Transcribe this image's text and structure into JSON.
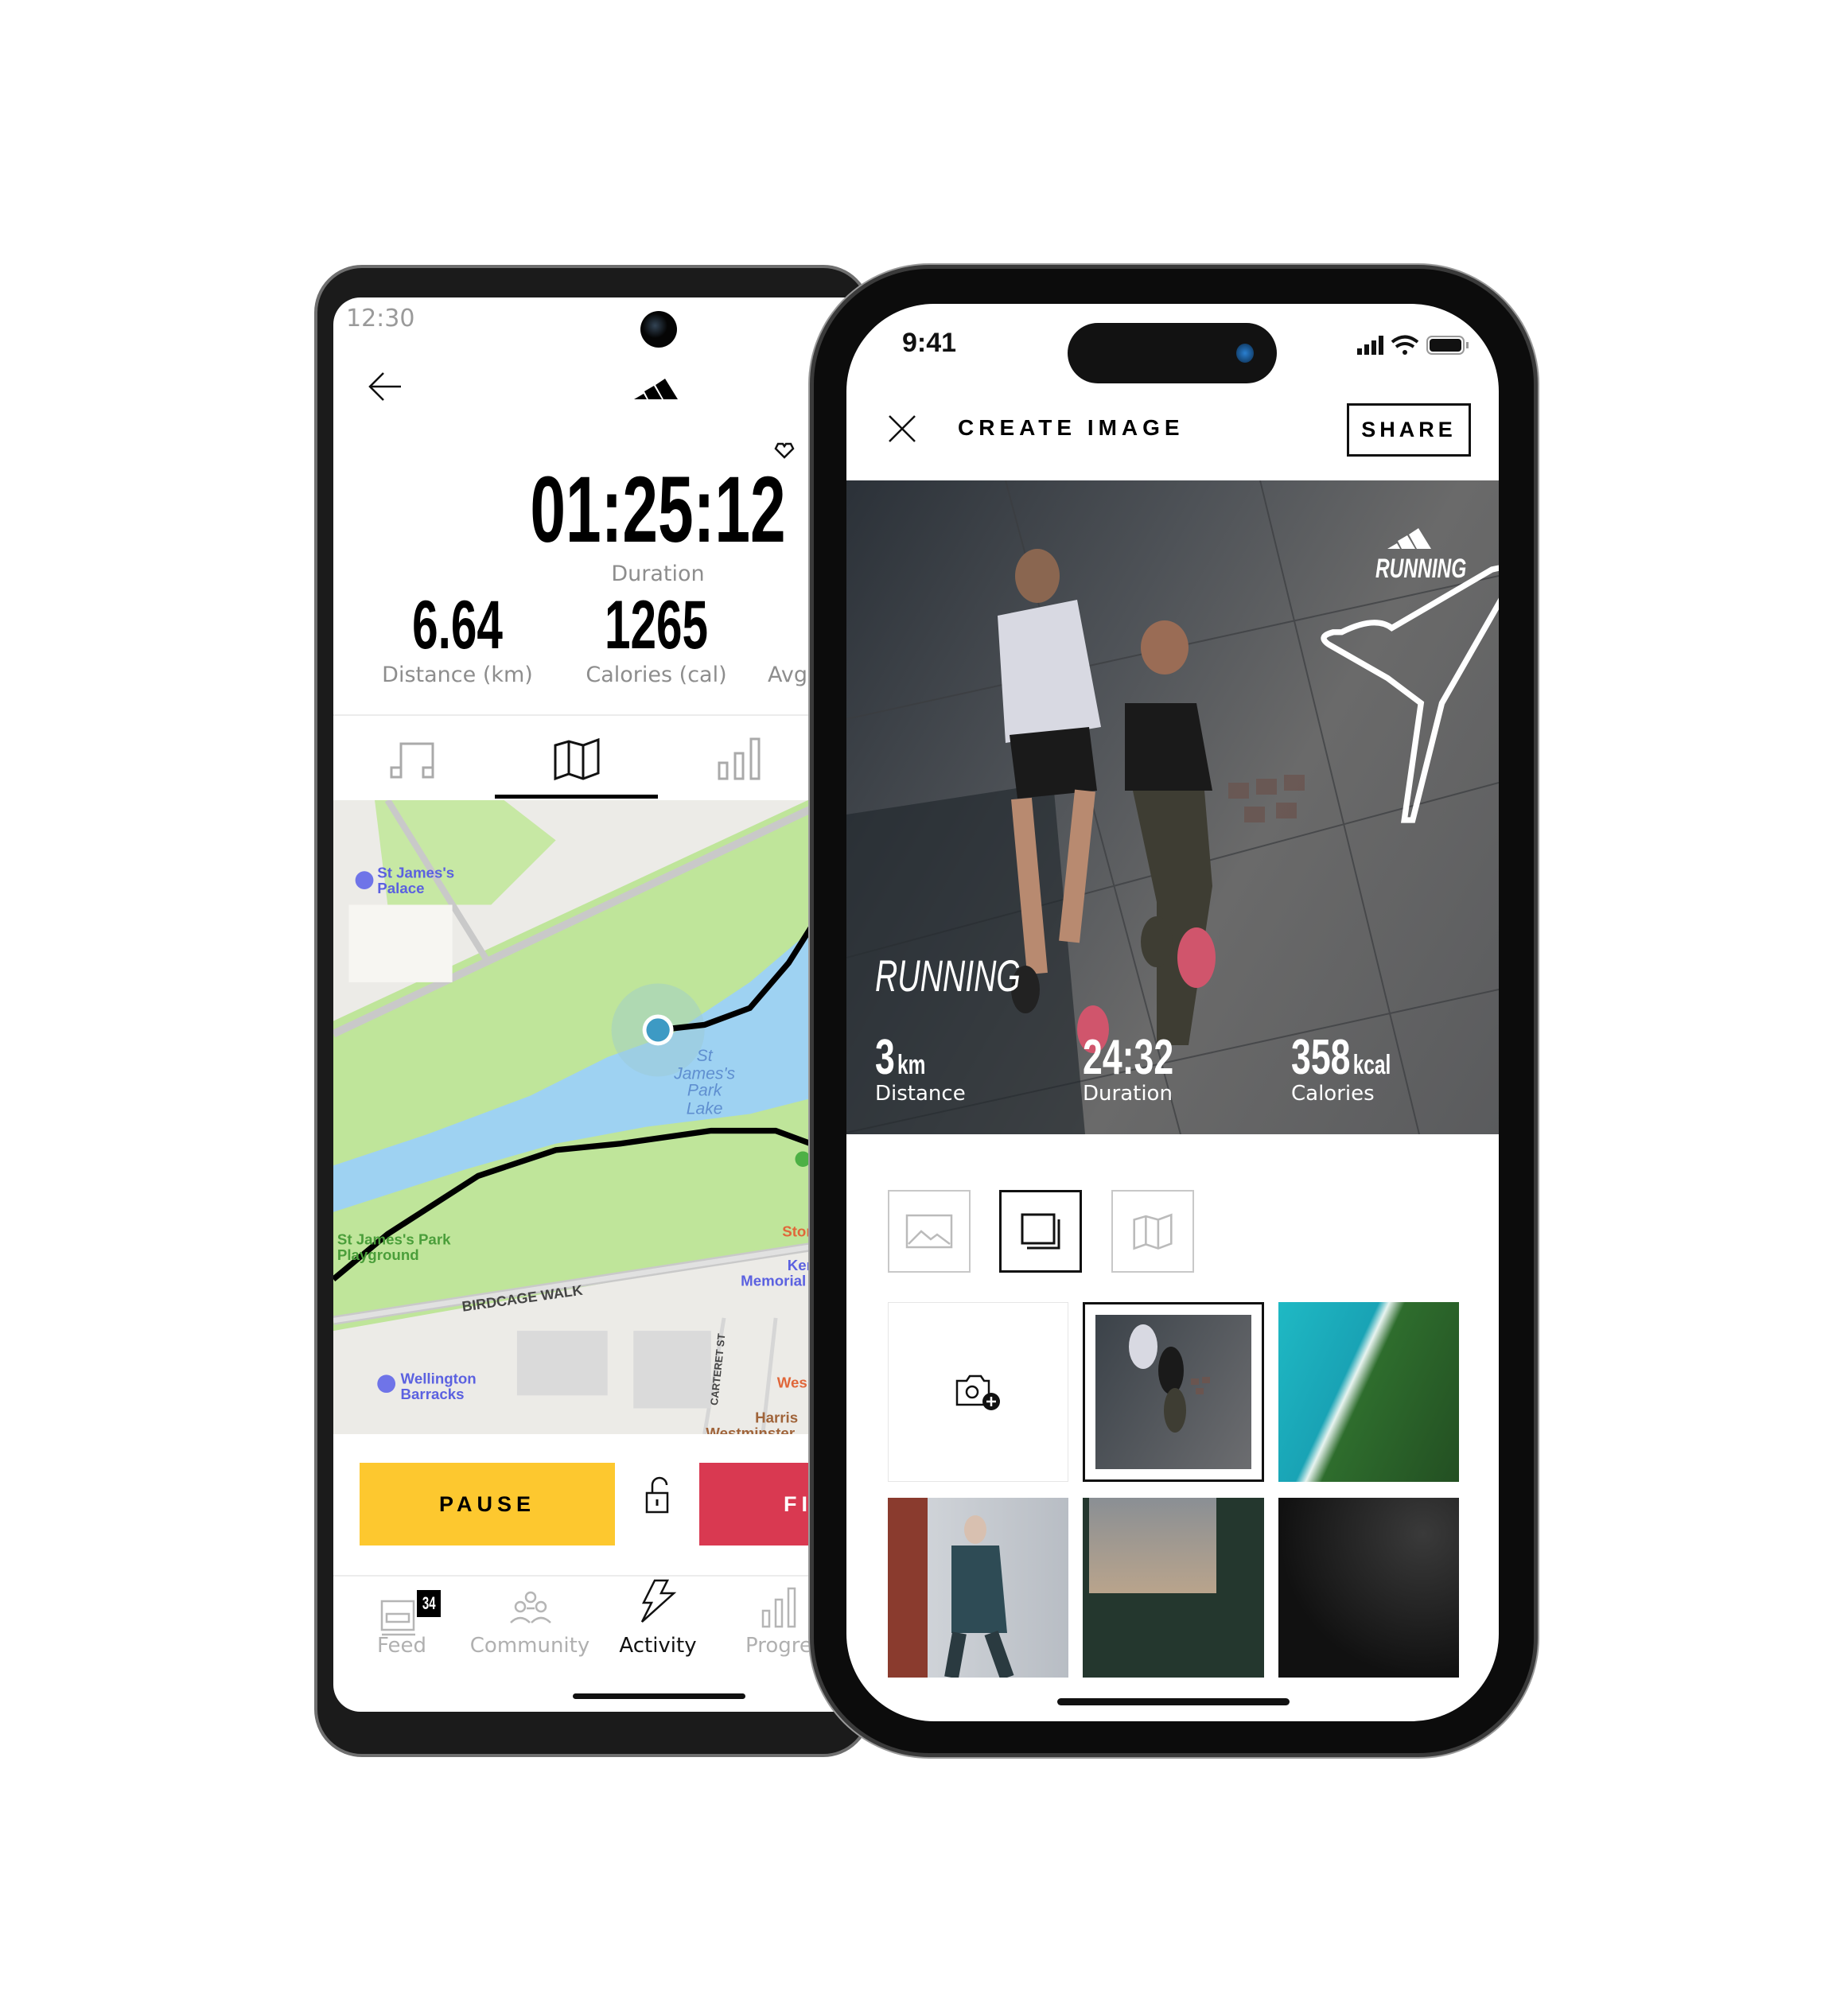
{
  "android": {
    "status_time": "12:30",
    "duration_value": "01:25:12",
    "duration_label": "Duration",
    "distance_value": "6.64",
    "distance_label": "Distance (km)",
    "calories_value": "1265",
    "calories_label": "Calories (cal)",
    "avg_label": "Avg.",
    "tabs": [
      {
        "icon": "music-icon",
        "active": false
      },
      {
        "icon": "map-icon",
        "active": true
      },
      {
        "icon": "stats-icon",
        "active": false
      }
    ],
    "map_labels": {
      "palace_1": "St James's",
      "palace_2": "Palace",
      "lake_1": "St",
      "lake_2": "James's",
      "lake_3": "Park",
      "lake_4": "Lake",
      "playground_1": "St James's Park",
      "playground_2": "Playground",
      "road": "BIRDCAGE WALK",
      "street": "CARTERET ST",
      "barracks_1": "Wellington",
      "barracks_2": "Barracks",
      "store": "Stor",
      "memorial_1": "Ken",
      "memorial_2": "Memorial",
      "west": "Wes",
      "harris_1": "Harris",
      "harris_2": "Westminster"
    },
    "pause_label": "PAUSE",
    "finish_label": "FI",
    "nav": [
      {
        "label": "Feed",
        "badge": "34",
        "active": false
      },
      {
        "label": "Community",
        "active": false
      },
      {
        "label": "Activity",
        "active": true
      },
      {
        "label": "Progre",
        "active": false
      }
    ],
    "colors": {
      "pause": "#FDC82F",
      "finish": "#D93951",
      "route": "#000000",
      "position": "#3D9AC4"
    }
  },
  "iphone": {
    "status_time": "9:41",
    "title": "CREATE IMAGE",
    "share_label": "SHARE",
    "card": {
      "brand_label": "RUNNING",
      "activity_label": "RUNNING",
      "stats": [
        {
          "value": "3",
          "unit": "km",
          "label": "Distance"
        },
        {
          "value": "24:32",
          "unit": "",
          "label": "Duration"
        },
        {
          "value": "358",
          "unit": "kcal",
          "label": "Calories"
        }
      ]
    },
    "templates": [
      {
        "icon": "image-icon",
        "selected": false
      },
      {
        "icon": "frame-icon",
        "selected": true
      },
      {
        "icon": "map-icon",
        "selected": false
      }
    ],
    "gallery_selected_index": 1
  }
}
